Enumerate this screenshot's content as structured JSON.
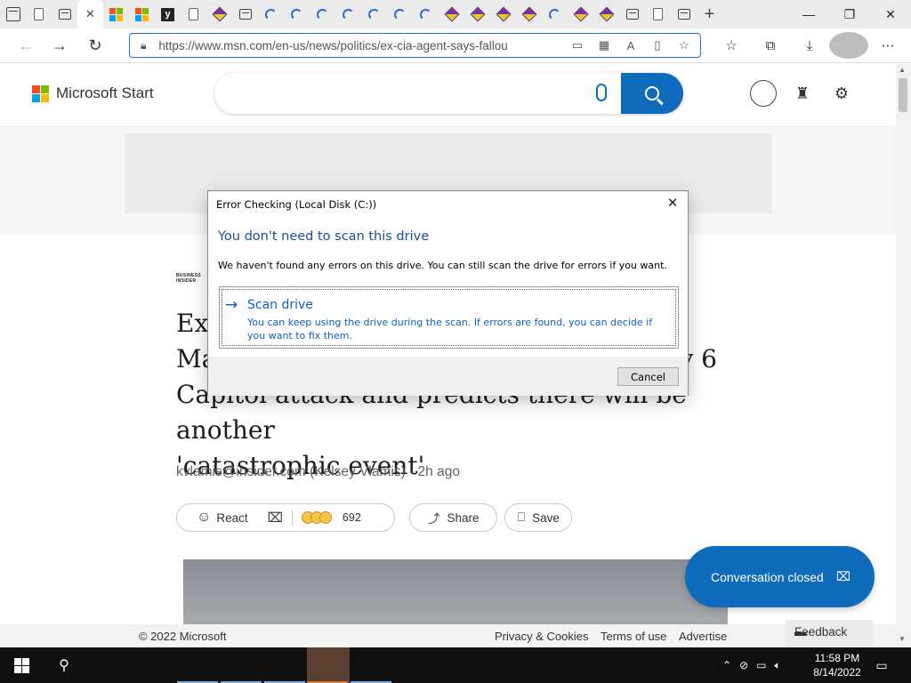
{
  "browser": {
    "url": "https://www.msn.com/en-us/news/politics/ex-cia-agent-says-fallou",
    "tab_close_glyph": "✕",
    "new_tab_glyph": "+",
    "window_controls": {
      "minimize": "—",
      "restore": "❐",
      "close": "✕"
    }
  },
  "site": {
    "logo_text": "Microsoft Start",
    "search_placeholder": ""
  },
  "article": {
    "publisher_line1": "BUSINESS",
    "publisher_line2": "INSIDER",
    "headline": "Ex-CIA agent says fallout from Trump's false claims has reached Ma… and Jan 6 Capitol attack and predicts there will be another 'catastrophic event'",
    "headline_visible_lines": [
      "Ex-",
      "Ma",
      "y 6",
      "Capitol attack and predicts there will be another",
      "'catastrophic event'"
    ],
    "byline": "kvlamis@insider.com (Kelsey Vlamis) - 2h ago",
    "react_label": "React",
    "reaction_count": "692",
    "share_label": "Share",
    "save_label": "Save"
  },
  "chat": {
    "label": "Conversation closed"
  },
  "footer": {
    "copyright": "© 2022 Microsoft",
    "privacy": "Privacy & Cookies",
    "terms": "Terms of use",
    "advertise": "Advertise",
    "feedback": "Feedback"
  },
  "dialog": {
    "title": "Error Checking (Local Disk (C:))",
    "close_glyph": "✕",
    "heading": "You don't need to scan this drive",
    "message": "We haven't found any errors on this drive. You can still scan the drive for errors if you want.",
    "option_label": "Scan drive",
    "option_description": "You can keep using the drive during the scan. If errors are found, you can decide if you want to fix them.",
    "cancel_label": "Cancel"
  },
  "taskbar": {
    "time": "11:58 PM",
    "date": "8/14/2022"
  },
  "colors": {
    "accent": "#0f6cbd",
    "dialog_link": "#1060c0"
  }
}
